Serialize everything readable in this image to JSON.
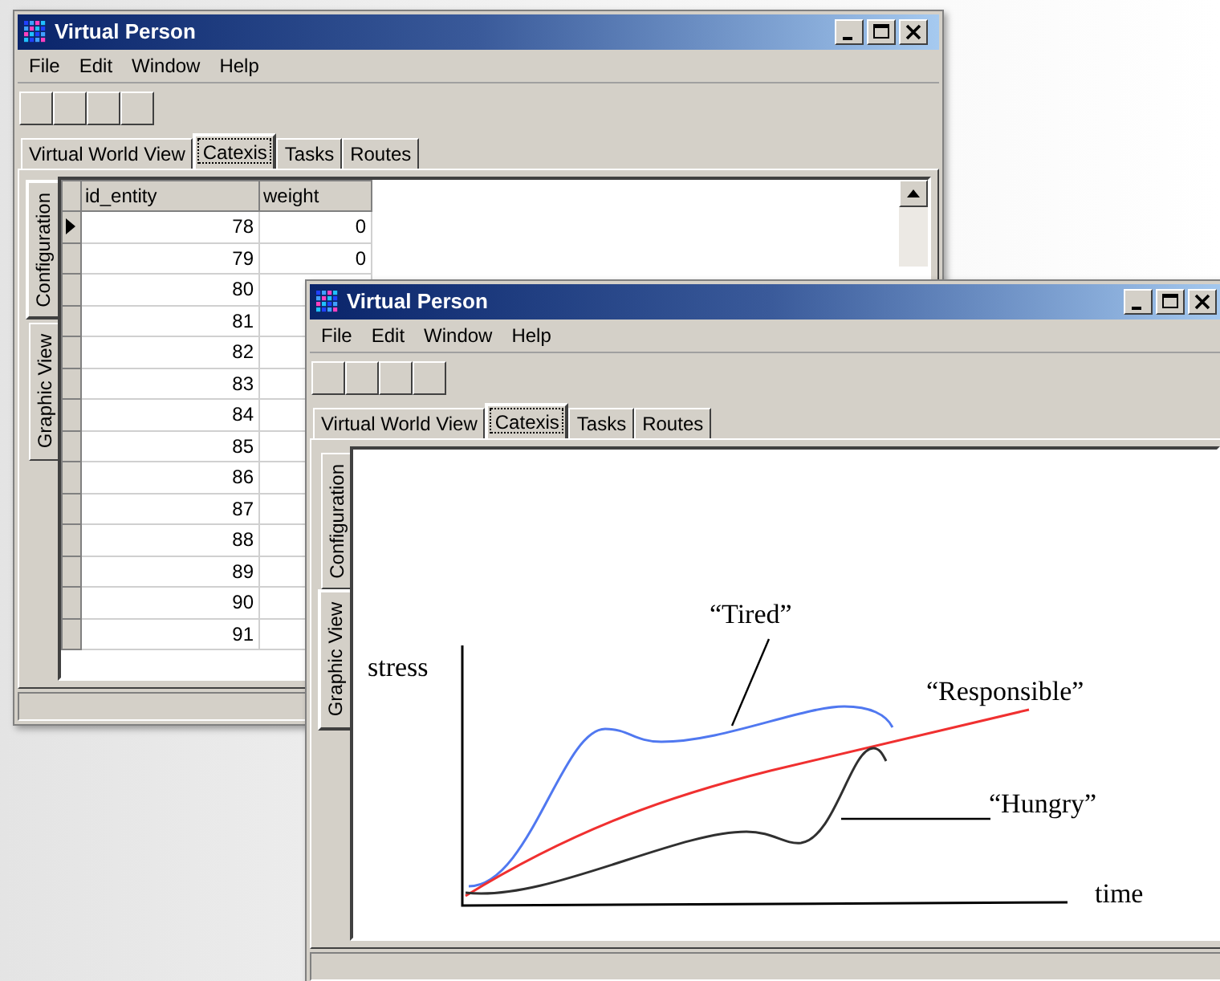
{
  "windows": [
    {
      "kind": "table",
      "title": "Virtual Person",
      "menu": [
        "File",
        "Edit",
        "Window",
        "Help"
      ],
      "tabs": [
        {
          "label": "Virtual World View",
          "selected": false
        },
        {
          "label": "Catexis",
          "selected": true
        },
        {
          "label": "Tasks",
          "selected": false
        },
        {
          "label": "Routes",
          "selected": false
        }
      ],
      "side_tabs": [
        {
          "label": "Configuration",
          "selected": true
        },
        {
          "label": "Graphic View",
          "selected": false
        }
      ],
      "table": {
        "columns": [
          "id_entity",
          "weight"
        ],
        "rows": [
          {
            "current": true,
            "cells": [
              "78",
              "0"
            ]
          },
          {
            "current": false,
            "cells": [
              "79",
              "0"
            ]
          },
          {
            "current": false,
            "cells": [
              "80"
            ]
          },
          {
            "current": false,
            "cells": [
              "81"
            ]
          },
          {
            "current": false,
            "cells": [
              "82"
            ]
          },
          {
            "current": false,
            "cells": [
              "83"
            ]
          },
          {
            "current": false,
            "cells": [
              "84"
            ]
          },
          {
            "current": false,
            "cells": [
              "85"
            ]
          },
          {
            "current": false,
            "cells": [
              "86"
            ]
          },
          {
            "current": false,
            "cells": [
              "87"
            ]
          },
          {
            "current": false,
            "cells": [
              "88"
            ]
          },
          {
            "current": false,
            "cells": [
              "89"
            ]
          },
          {
            "current": false,
            "cells": [
              "90"
            ]
          },
          {
            "current": false,
            "cells": [
              "91"
            ]
          }
        ]
      }
    },
    {
      "kind": "graph",
      "title": "Virtual Person",
      "menu": [
        "File",
        "Edit",
        "Window",
        "Help"
      ],
      "tabs": [
        {
          "label": "Virtual World View",
          "selected": false
        },
        {
          "label": "Catexis",
          "selected": true
        },
        {
          "label": "Tasks",
          "selected": false
        },
        {
          "label": "Routes",
          "selected": false
        }
      ],
      "side_tabs": [
        {
          "label": "Configuration",
          "selected": false
        },
        {
          "label": "Graphic View",
          "selected": true
        }
      ],
      "graph": {
        "y_label": "stress",
        "x_label": "time",
        "curves": [
          {
            "label": "“Tired”",
            "color": "#5078f0"
          },
          {
            "label": "“Responsible”",
            "color": "#f03030"
          },
          {
            "label": "“Hungry”",
            "color": "#303030"
          }
        ]
      }
    }
  ]
}
